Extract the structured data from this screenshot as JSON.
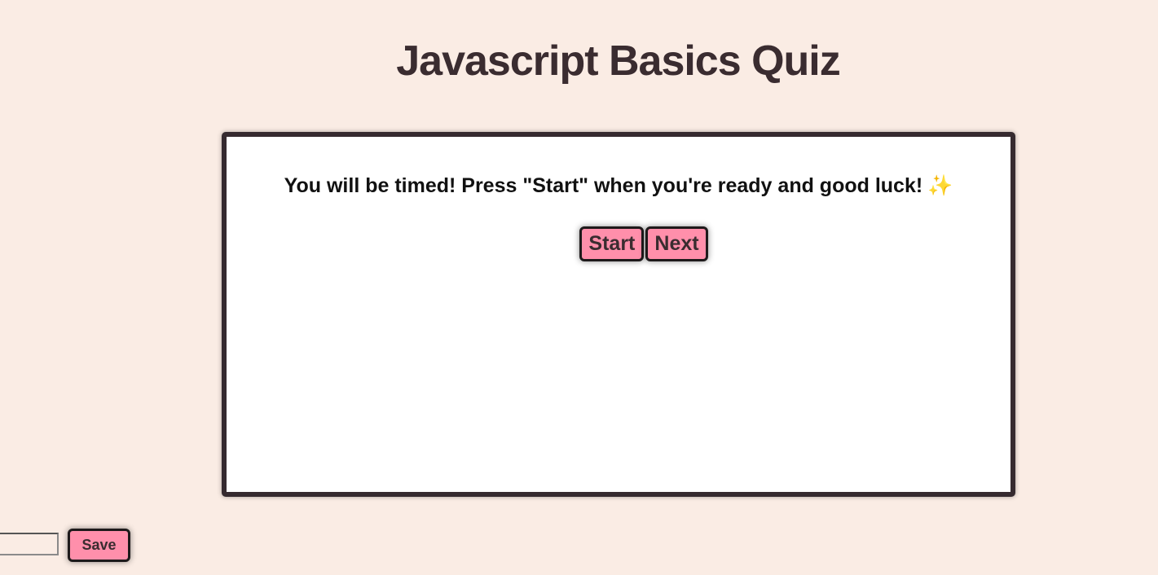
{
  "header": {
    "title": "Javascript Basics Quiz"
  },
  "quiz": {
    "instructions": "You will be timed! Press \"Start\" when you're ready and good luck!",
    "sparkle_icon": "✨",
    "start_label": "Start",
    "next_label": "Next"
  },
  "score_form": {
    "name_value": "",
    "save_label": "Save"
  },
  "colors": {
    "background": "#faece4",
    "button": "#ff8fab",
    "border": "#352a2f",
    "title": "#3a2c30"
  }
}
